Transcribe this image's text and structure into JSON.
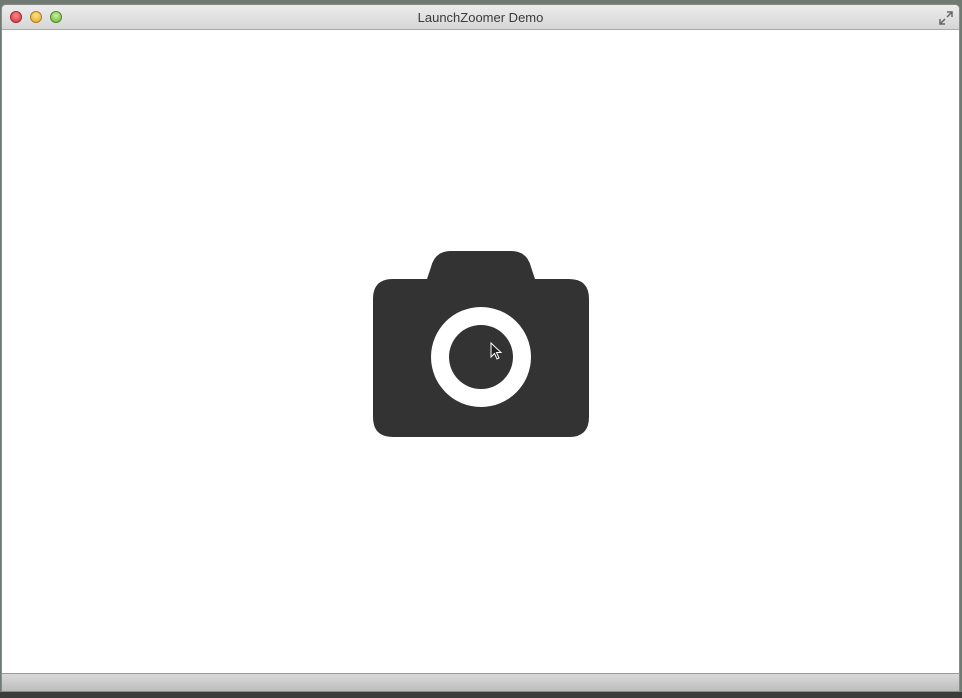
{
  "window": {
    "title": "LaunchZoomer Demo"
  },
  "icons": {
    "close": "close-button",
    "minimize": "minimize-button",
    "zoom": "zoom-button",
    "fullscreen": "fullscreen-icon",
    "camera": "camera-icon",
    "cursor": "mouse-cursor-icon"
  },
  "colors": {
    "camera_fill": "#333333",
    "content_background": "#ffffff"
  }
}
